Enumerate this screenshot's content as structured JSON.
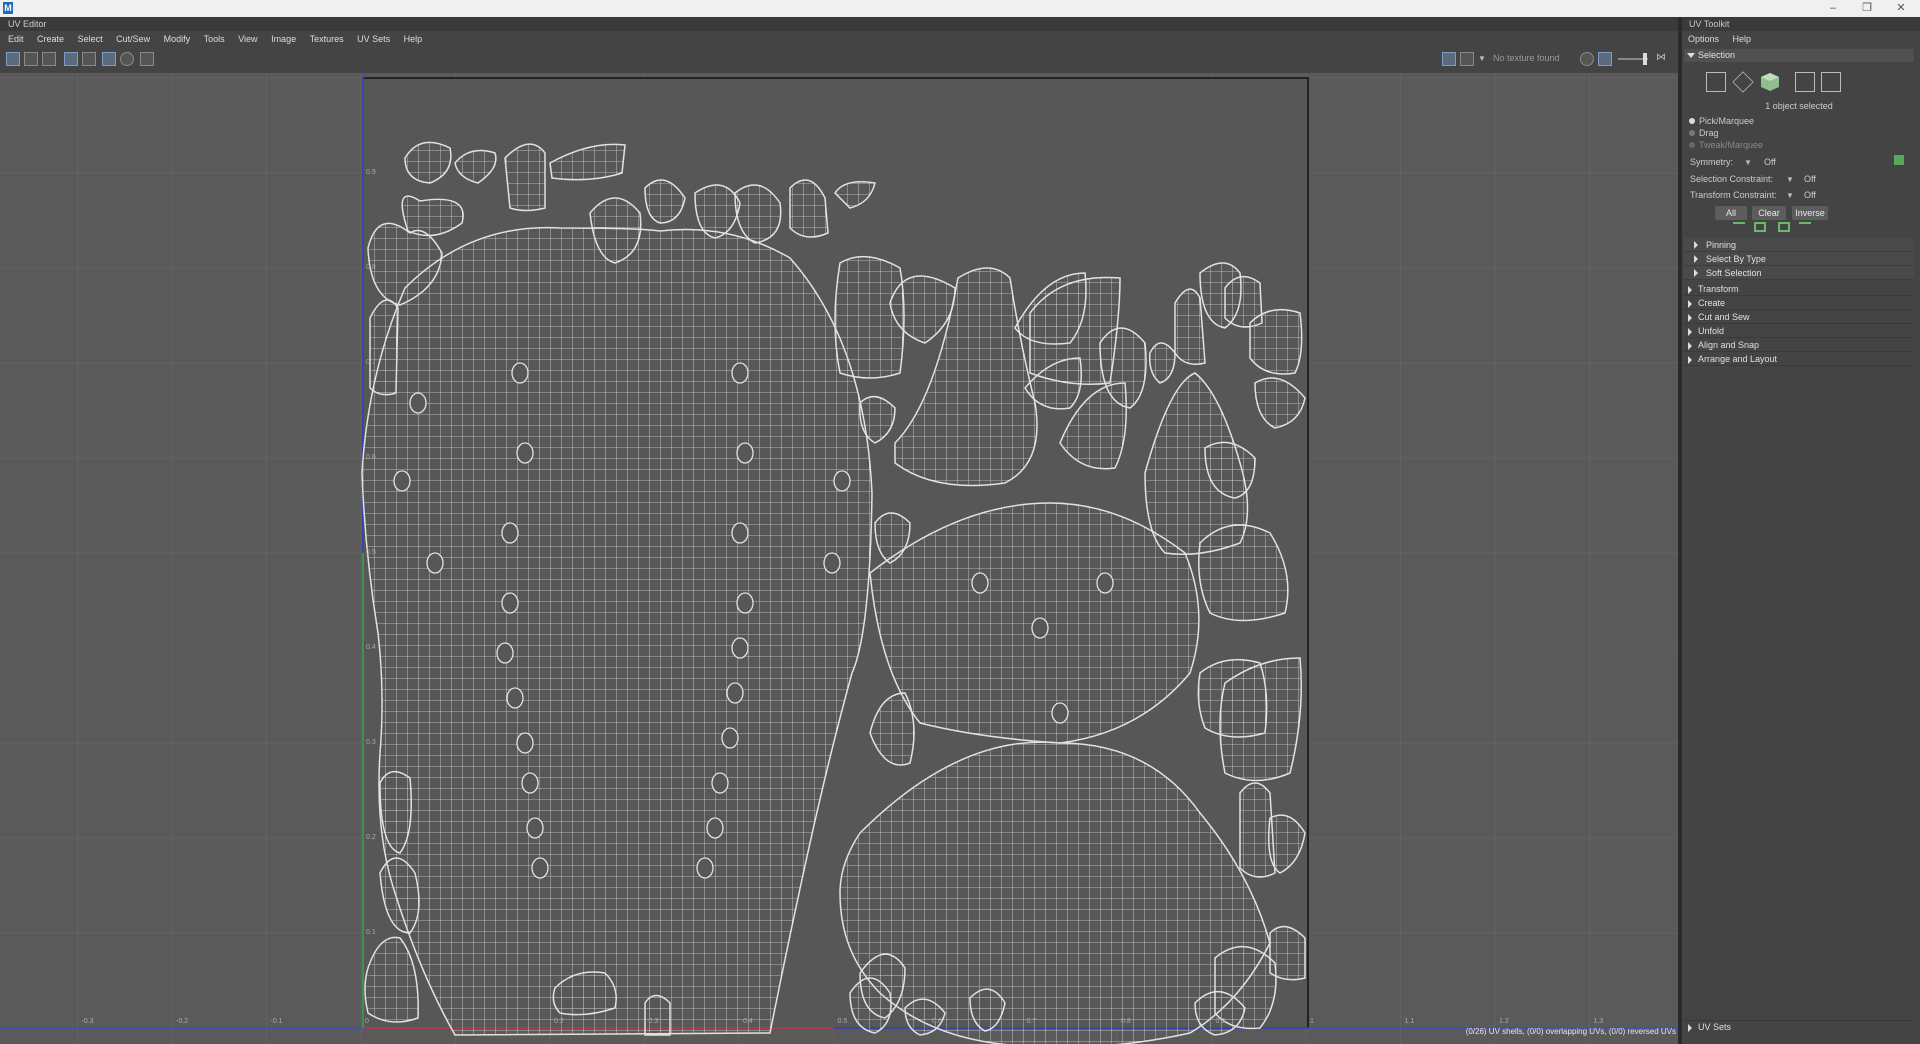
{
  "app": {
    "icon": "maya-icon",
    "window_controls": [
      "minimize",
      "restore",
      "close"
    ]
  },
  "uv_editor": {
    "panel_title": "UV Editor",
    "menu": [
      "Edit",
      "Create",
      "Select",
      "Cut/Sew",
      "Modify",
      "Tools",
      "View",
      "Image",
      "Textures",
      "UV Sets",
      "Help"
    ],
    "toolbar_status": "No texture found",
    "status_text": "(0/26) UV shells, (0/0) overlapping UVs, (0/0) reversed UVs",
    "x_tick_labels": [
      "-0.3",
      "-0.2",
      "-0.1",
      "0",
      "0.2",
      "0.3",
      "0.4",
      "0.5",
      "0.6",
      "0.7",
      "0.8",
      "0.9",
      "1",
      "1.1",
      "1.2",
      "1.3"
    ],
    "y_tick_labels": [
      "0.9",
      "0.8",
      "0.7",
      "0.6",
      "0.5",
      "0.4",
      "0.3",
      "0.2",
      "0.1"
    ],
    "axis_colors": {
      "u_axis": "#c83c3c",
      "v_axis": "#3cb03c",
      "grid_axis": "#3c4cc8"
    },
    "uv_shell_count": 26
  },
  "uv_toolkit": {
    "panel_title": "UV Toolkit",
    "menu": [
      "Options",
      "Help"
    ],
    "selection": {
      "header": "Selection",
      "summary": "1 object selected",
      "modes": [
        "Pick/Marquee",
        "Drag",
        "Tweak/Marquee"
      ],
      "symmetry_label": "Symmetry:",
      "symmetry_value": "Off",
      "selection_constraint_label": "Selection Constraint:",
      "selection_constraint_value": "Off",
      "transform_constraint_label": "Transform Constraint:",
      "transform_constraint_value": "Off",
      "buttons": [
        "All",
        "Clear",
        "Inverse"
      ],
      "subsections": [
        "Pinning",
        "Select By Type",
        "Soft Selection"
      ]
    },
    "sections": [
      "Transform",
      "Create",
      "Cut and Sew",
      "Unfold",
      "Align and Snap",
      "Arrange and Layout"
    ],
    "uv_sets_header": "UV Sets"
  }
}
